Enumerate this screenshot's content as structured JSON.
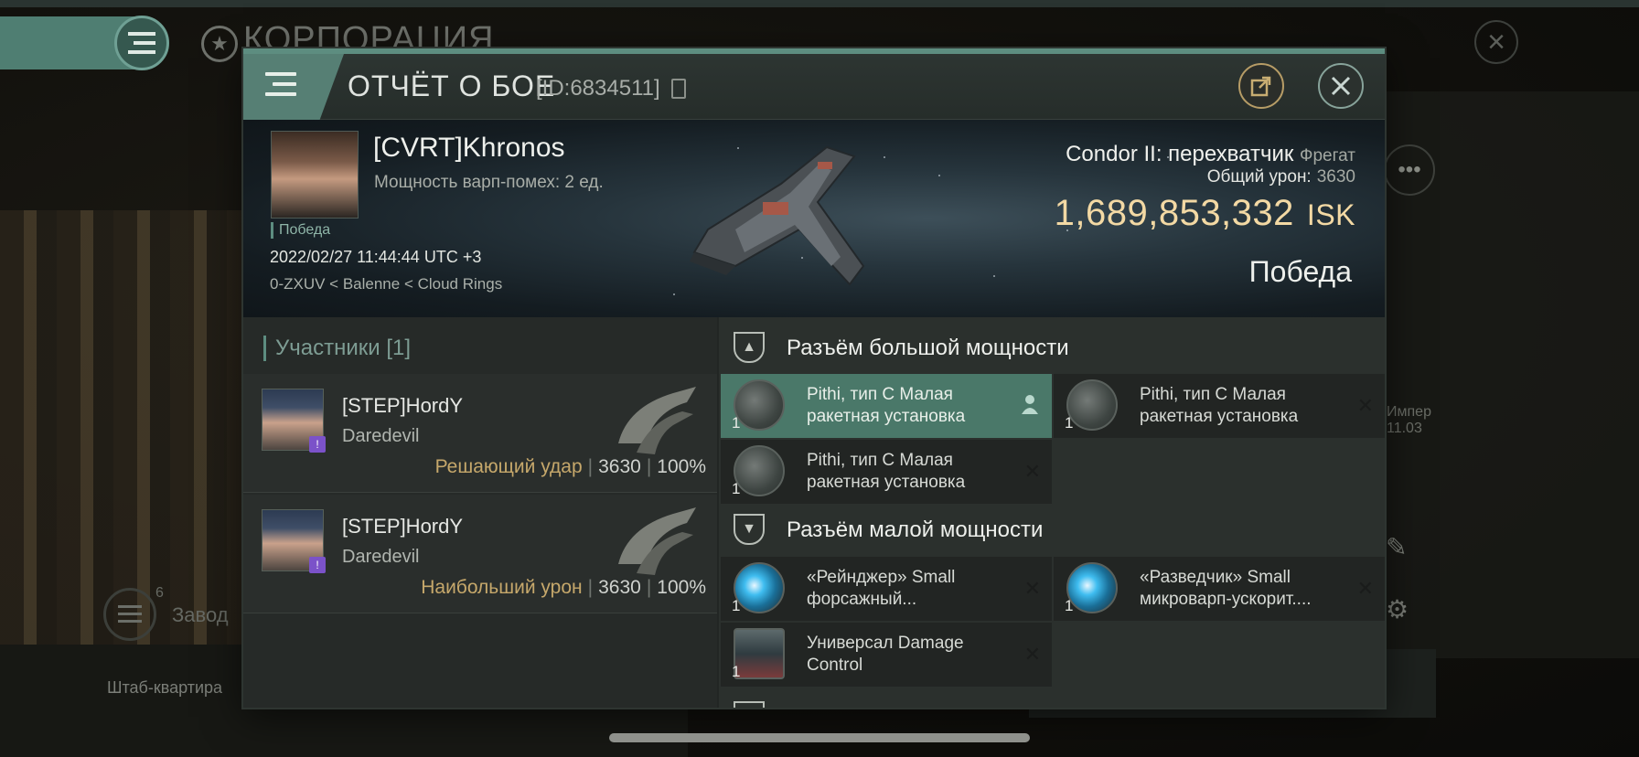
{
  "background": {
    "section_title": "КОРПОРАЦИЯ",
    "factory_label": "Завод",
    "factory_count": "6",
    "hq_label": "Штаб-квартира",
    "right_side_text_1": "Импер",
    "right_side_text_2": "11.03"
  },
  "report": {
    "title": "ОТЧЁТ О БОЕ",
    "id": "[ID:6834511]",
    "pilot": {
      "name": "[CVRT]Khronos",
      "warp_strength": "Мощность варп-помех: 2 ед.",
      "tag": "Победа",
      "date": "2022/02/27 11:44:44 UTC +3",
      "location": "0-ZXUV < Balenne < Cloud Rings"
    },
    "ship": {
      "name": "Condor II: перехватчик",
      "class": "Фрегат",
      "total_damage_label": "Общий урон:",
      "total_damage": "3630",
      "isk_value": "1,689,853,332",
      "isk_unit": "ISK",
      "result": "Победа"
    },
    "participants": {
      "label": "Участники",
      "count": "[1]",
      "rows": [
        {
          "name": "[STEP]HordY",
          "ship": "Daredevil",
          "role": "Решающий удар",
          "damage": "3630",
          "percent": "100%"
        },
        {
          "name": "[STEP]HordY",
          "ship": "Daredevil",
          "role": "Наибольший урон",
          "damage": "3630",
          "percent": "100%"
        }
      ]
    },
    "fittings": {
      "high_slots_title": "Разъём большой мощности",
      "low_slots_title": "Разъём малой мощности",
      "high_modules": [
        {
          "name": "Pithi, тип С Малая ракетная установка",
          "qty": "1"
        },
        {
          "name": "Pithi, тип С Малая ракетная установка",
          "qty": "1"
        },
        {
          "name": "Pithi, тип С Малая ракетная установка",
          "qty": "1"
        }
      ],
      "low_modules": [
        {
          "name": "«Рейнджер» Small форсажный...",
          "qty": "1"
        },
        {
          "name": "«Разведчик» Small микроварп-ускорит....",
          "qty": "1"
        },
        {
          "name": "Универсал Damage Control",
          "qty": "1"
        }
      ]
    },
    "colors": {
      "accent": "#5d8d80",
      "isk": "#f3d9a4",
      "role": "#c6a86b"
    }
  }
}
